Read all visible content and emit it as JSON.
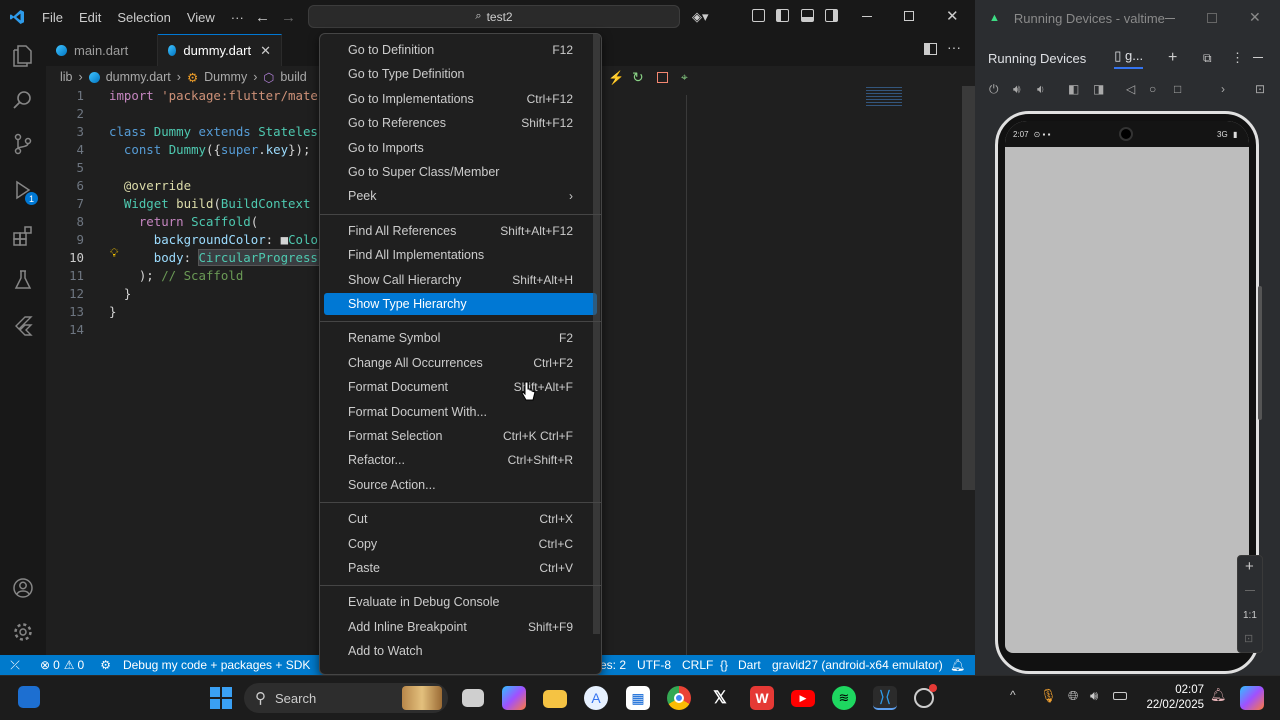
{
  "titlebar": {
    "menus": [
      "File",
      "Edit",
      "Selection",
      "View",
      "···"
    ],
    "search": "test2"
  },
  "tabs": [
    {
      "label": "main.dart"
    },
    {
      "label": "dummy.dart",
      "active": true
    }
  ],
  "breadcrumb": [
    "lib",
    "dummy.dart",
    "Dummy",
    "build"
  ],
  "code": [
    {
      "n": "1",
      "parts": [
        [
          "kw2",
          "import "
        ],
        [
          "st",
          "'package:flutter/mater"
        ]
      ]
    },
    {
      "n": "2",
      "parts": []
    },
    {
      "n": "3",
      "parts": [
        [
          "kw",
          "class "
        ],
        [
          "ty",
          "Dummy "
        ],
        [
          "kw",
          "extends "
        ],
        [
          "ty",
          "Stateless"
        ]
      ]
    },
    {
      "n": "4",
      "parts": [
        [
          "pl",
          "  "
        ],
        [
          "kw",
          "const "
        ],
        [
          "ty",
          "Dummy"
        ],
        [
          "pl",
          "({"
        ],
        [
          "kw",
          "super"
        ],
        [
          "pl",
          "."
        ],
        [
          "vr",
          "key"
        ],
        [
          "pl",
          "});"
        ]
      ]
    },
    {
      "n": "5",
      "parts": []
    },
    {
      "n": "6",
      "parts": [
        [
          "pl",
          "  "
        ],
        [
          "ann",
          "@override"
        ]
      ]
    },
    {
      "n": "7",
      "parts": [
        [
          "pl",
          "  "
        ],
        [
          "ty",
          "Widget "
        ],
        [
          "fn",
          "build"
        ],
        [
          "pl",
          "("
        ],
        [
          "ty",
          "BuildContext "
        ],
        [
          "vr",
          "c"
        ]
      ]
    },
    {
      "n": "8",
      "parts": [
        [
          "pl",
          "    "
        ],
        [
          "kw2",
          "return "
        ],
        [
          "ty",
          "Scaffold"
        ],
        [
          "pl",
          "("
        ]
      ]
    },
    {
      "n": "9",
      "parts": [
        [
          "pl",
          "      "
        ],
        [
          "vr",
          "backgroundColor"
        ],
        [
          "pl",
          ": ■"
        ],
        [
          "ty",
          "Colo"
        ]
      ]
    },
    {
      "n": "10",
      "parts": [
        [
          "pl",
          "      "
        ],
        [
          "vr",
          "body"
        ],
        [
          "pl",
          ": "
        ],
        [
          "ty",
          "CircularProgressI"
        ]
      ]
    },
    {
      "n": "11",
      "parts": [
        [
          "pl",
          "    ); "
        ],
        [
          "cm",
          "// Scaffold"
        ]
      ]
    },
    {
      "n": "12",
      "parts": [
        [
          "pl",
          "  }"
        ]
      ]
    },
    {
      "n": "13",
      "parts": [
        [
          "pl",
          "}"
        ]
      ]
    },
    {
      "n": "14",
      "parts": []
    }
  ],
  "context_menu": {
    "groups": [
      [
        {
          "label": "Go to Definition",
          "kb": "F12"
        },
        {
          "label": "Go to Type Definition",
          "kb": ""
        },
        {
          "label": "Go to Implementations",
          "kb": "Ctrl+F12"
        },
        {
          "label": "Go to References",
          "kb": "Shift+F12"
        },
        {
          "label": "Go to Imports",
          "kb": ""
        },
        {
          "label": "Go to Super Class/Member",
          "kb": ""
        },
        {
          "label": "Peek",
          "kb": "›"
        }
      ],
      [
        {
          "label": "Find All References",
          "kb": "Shift+Alt+F12"
        },
        {
          "label": "Find All Implementations",
          "kb": ""
        },
        {
          "label": "Show Call Hierarchy",
          "kb": "Shift+Alt+H"
        },
        {
          "label": "Show Type Hierarchy",
          "kb": "",
          "selected": true
        }
      ],
      [
        {
          "label": "Rename Symbol",
          "kb": "F2"
        },
        {
          "label": "Change All Occurrences",
          "kb": "Ctrl+F2"
        },
        {
          "label": "Format Document",
          "kb": "Shift+Alt+F"
        },
        {
          "label": "Format Document With...",
          "kb": ""
        },
        {
          "label": "Format Selection",
          "kb": "Ctrl+K Ctrl+F"
        },
        {
          "label": "Refactor...",
          "kb": "Ctrl+Shift+R"
        },
        {
          "label": "Source Action...",
          "kb": ""
        }
      ],
      [
        {
          "label": "Cut",
          "kb": "Ctrl+X"
        },
        {
          "label": "Copy",
          "kb": "Ctrl+C"
        },
        {
          "label": "Paste",
          "kb": "Ctrl+V"
        }
      ],
      [
        {
          "label": "Evaluate in Debug Console",
          "kb": ""
        },
        {
          "label": "Add Inline Breakpoint",
          "kb": "Shift+F9"
        },
        {
          "label": "Add to Watch",
          "kb": ""
        }
      ]
    ]
  },
  "statusbar": {
    "errors": "0",
    "warnings": "0",
    "debug": "Debug my code + packages + SDK",
    "spaces": "es: 2",
    "encoding": "UTF-8",
    "eol": "CRLF",
    "language": "Dart",
    "device": "gravid27 (android-x64 emulator)"
  },
  "emulator": {
    "window_title": "Running Devices - valtime",
    "panel_title": "Running Devices",
    "tab": "g...",
    "phone_time": "2:07",
    "phone_net": "3G",
    "zoom": "1:1"
  },
  "taskbar": {
    "search": "Search",
    "time": "02:07",
    "date": "22/02/2025"
  }
}
